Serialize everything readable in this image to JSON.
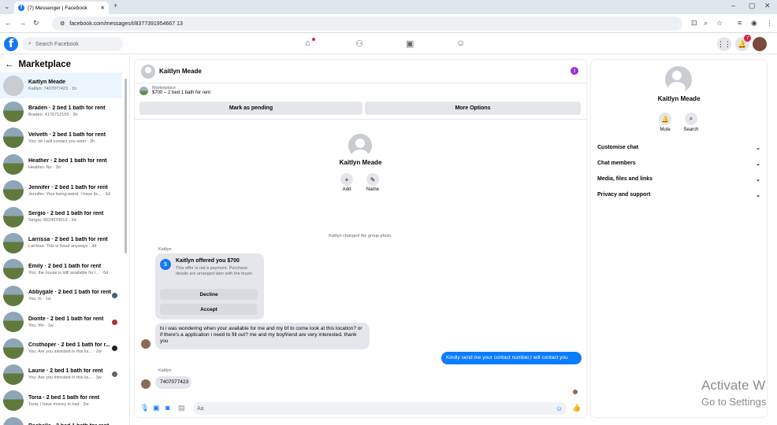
{
  "browser": {
    "tab_title": "(7) Messenger | Facebook",
    "url": "facebook.com/messages/t/8377391954667 13"
  },
  "fb": {
    "search_placeholder": "Search Facebook",
    "notifications_badge": "7"
  },
  "left": {
    "title": "Marketplace",
    "conversations": [
      {
        "title": "Kaitlyn Meade",
        "sub": "Kaitlyn: 7407077423 · 1h",
        "selected": true
      },
      {
        "title": "Braden · 2 bed 1 bath for rent",
        "sub": "Braden: 4176712155 · 3h"
      },
      {
        "title": "Velveth · 2 bed 1 bath for rent",
        "sub": "You: ok i will contact you soon · 3h"
      },
      {
        "title": "Heather · 2 bed 1 bath for rent",
        "sub": "Heather: No · 3d"
      },
      {
        "title": "Jennifer · 2 bed 1 bath for rent",
        "sub": "Jennifer: Your being weird. I have lis... · 3d"
      },
      {
        "title": "Sergio · 2 bed 1 bath for rent",
        "sub": "Sergio: 6624970012 · 3d"
      },
      {
        "title": "Larrissa · 2 bed 1 bath for rent",
        "sub": "Larrissa: This is fraud anyways · 4d"
      },
      {
        "title": "Emily · 2 bed 1 bath for rent",
        "sub": "You: the house is still available for r... · 6d"
      },
      {
        "title": "Abbygale · 2 bed 1 bath for rent",
        "sub": "You: hi · 1w"
      },
      {
        "title": "Dionte · 2 bed 1 bath for rent",
        "sub": "You: hhi · 1w"
      },
      {
        "title": "Cristhoper · 2 bed 1 bath for r...",
        "sub": "You: Are you intrested in this lis... · 2w"
      },
      {
        "title": "Laurie · 2 bed 1 bath for rent",
        "sub": "You: Are you intrested in this lis... · 3w"
      },
      {
        "title": "Toria · 2 bed 1 bath for rent",
        "sub": "Toria: I have money in had · 3w"
      },
      {
        "title": "Rachelle · 2 bed 1 bath for rent",
        "sub": ""
      }
    ]
  },
  "chat": {
    "name": "Kaitlyn Meade",
    "marketplace_label": "Marketplace",
    "listing": "$700 – 2 bed 1 bath for rent",
    "mark_pending": "Mark as pending",
    "more_options": "More Options",
    "profile_name": "Kaitlyn Meade",
    "add_label": "Add",
    "name_label": "Name",
    "system_msg": "Kaitlyn changed the group photo.",
    "sender1": "Kaitlyn",
    "offer_title": "Kaitlyn offered you $700",
    "offer_body": "This offer is not a payment. Purchase details are arranged later with the buyer.",
    "decline": "Decline",
    "accept": "Accept",
    "msg1": "hi i was wondering when your available for me and my bf to come look at this location? or if there's a application i need to fill out? me and my boyfriend are very interested. thank you",
    "mine": "Kindly send me your contact number,I will contact you",
    "sender2": "Kaitlyn",
    "msg2": "7407077423",
    "composer_placeholder": "Aa"
  },
  "right": {
    "name": "Kaitlyn Meade",
    "mute": "Mute",
    "search": "Search",
    "rows": [
      "Customise chat",
      "Chat members",
      "Media, files and links",
      "Privacy and support"
    ]
  },
  "watermark": {
    "line1": "Activate W",
    "line2": "Go to Settings"
  },
  "colors": {
    "brand": "#1877f2",
    "my_bubble": "#0a7cff",
    "info": "#9b2fd3"
  }
}
